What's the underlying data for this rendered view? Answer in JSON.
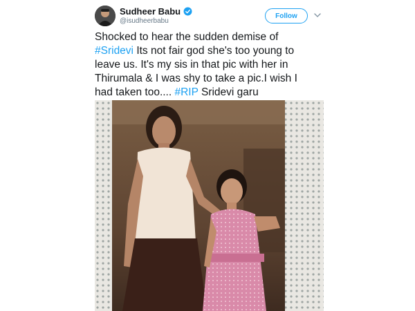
{
  "author": {
    "display_name": "Sudheer Babu",
    "handle": "@isudheerbabu",
    "verified": true,
    "avatar_icon": "profile-avatar-icon"
  },
  "actions": {
    "follow_label": "Follow",
    "menu_icon": "chevron-down-icon"
  },
  "tweet": {
    "lines": [
      "Shocked to hear the sudden demise of",
      "Its not fair god she's too young to",
      "leave us. It's my sis in that pic with her in",
      "Thirumala & I was shy to take a pic.I wish I",
      "had taken too....",
      "Sridevi garu"
    ],
    "hashtag_sridevi": "#Sridevi",
    "hashtag_rip": "#RIP"
  },
  "colors": {
    "link": "#1da1f2",
    "text": "#14171a",
    "muted": "#657786",
    "verified": "#1da1f2"
  },
  "media": {
    "icon": "vintage-photo-image"
  }
}
